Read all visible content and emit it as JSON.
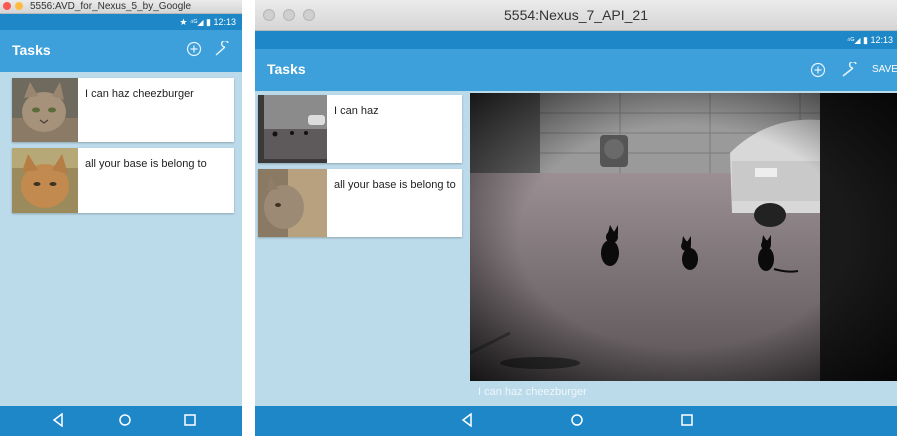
{
  "window1": {
    "title": "5556:AVD_for_Nexus_5_by_Google",
    "status_time": "12:13",
    "app_title": "Tasks",
    "tasks": [
      {
        "text": "I can haz cheezburger"
      },
      {
        "text": "all your base is belong to"
      }
    ]
  },
  "window2": {
    "title": "5554:Nexus_7_API_21",
    "status_time": "12:13",
    "app_title": "Tasks",
    "save_label": "SAVE",
    "tasks": [
      {
        "text": "I can haz"
      },
      {
        "text": "all your base is belong to"
      }
    ],
    "detail_caption": "I can haz  cheezburger"
  },
  "colors": {
    "app_bar": "#3da0da",
    "status_bar": "#1e87c8",
    "content_bg": "#bcdbea"
  }
}
